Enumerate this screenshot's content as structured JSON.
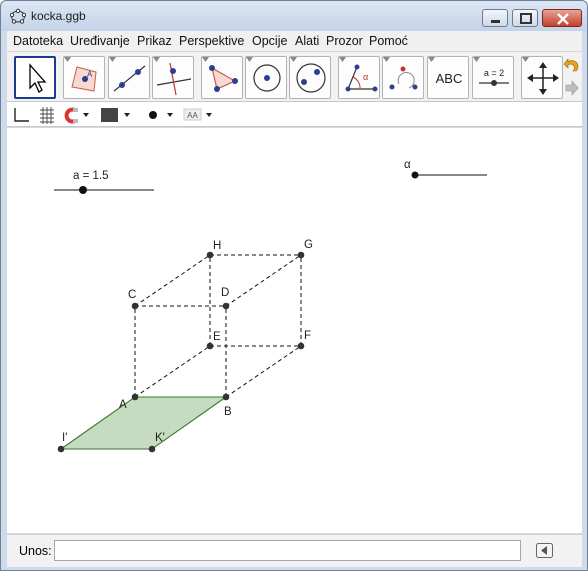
{
  "window": {
    "title": "kocka.ggb",
    "controls": [
      "minimize-icon",
      "maximize-icon",
      "close-icon"
    ]
  },
  "menu": [
    "Datoteka",
    "Uređivanje",
    "Prikaz",
    "Perspektive",
    "Opcije",
    "Alati",
    "Prozor",
    "Pomoć"
  ],
  "toolbar": {
    "tools": [
      "move-tool-icon",
      "polygon-point-icon",
      "line-tool-icon",
      "perpendicular-line-icon",
      "polygon-tool-icon",
      "circle-tool-icon",
      "conic-tool-icon",
      "angle-tool-icon",
      "reflect-tool-icon",
      "text-tool-icon",
      "slider-tool-icon",
      "move-view-icon"
    ],
    "text_tool_label": "ABC",
    "slider_tool_label": "a = 2",
    "active_tool": "move-tool-icon"
  },
  "stylebar": {
    "items": [
      "axes-toggle-icon",
      "grid-toggle-icon",
      "point-capture-icon",
      "color-swatch-icon",
      "point-style-icon",
      "label-style-icon"
    ],
    "label_style_text": "AA"
  },
  "graphics": {
    "slider_a_label": "a = 1.5",
    "slider_a_value": 1.5,
    "slider_alpha_label": "α",
    "points": {
      "H": "H",
      "G": "G",
      "C": "C",
      "D": "D",
      "E": "E",
      "F": "F",
      "A": "A",
      "B": "B",
      "I": "I'",
      "K": "K'"
    },
    "colors": {
      "polygon_fill": "#c5dcc0",
      "polygon_stroke": "#3c7a2e",
      "point": "#333333"
    }
  },
  "input": {
    "label": "Unos:",
    "value": "",
    "placeholder": ""
  }
}
